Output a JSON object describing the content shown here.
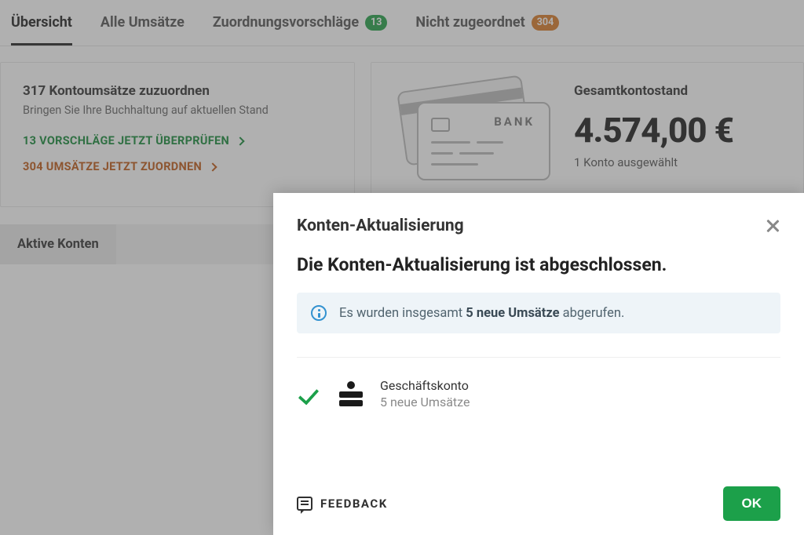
{
  "tabs": {
    "overview": "Übersicht",
    "all": "Alle Umsätze",
    "suggestions": "Zuordnungsvorschläge",
    "suggestions_badge": "13",
    "unassigned": "Nicht zugeordnet",
    "unassigned_badge": "304"
  },
  "left_card": {
    "heading": "317 Kontoumsätze zuzuordnen",
    "subtext": "Bringen Sie Ihre Buchhaltung auf aktuellen Stand",
    "action_green": "13 VORSCHLÄGE JETZT ÜBERPRÜFEN",
    "action_orange": "304 UMSÄTZE JETZT ZUORDNEN"
  },
  "balance": {
    "label": "Gesamtkontostand",
    "amount": "4.574,00 €",
    "sub": "1 Konto ausgewählt",
    "bank_word": "BANK"
  },
  "account_tabs": {
    "active": "Aktive Konten"
  },
  "modal": {
    "title": "Konten-Aktualisierung",
    "headline": "Die Konten-Aktualisierung ist abgeschlossen.",
    "info_pre": "Es wurden insgesamt ",
    "info_bold": "5 neue Umsätze",
    "info_post": " abgerufen.",
    "account": {
      "name": "Geschäftskonto",
      "meta": "5 neue Umsätze"
    },
    "feedback": "FEEDBACK",
    "ok": "OK"
  }
}
